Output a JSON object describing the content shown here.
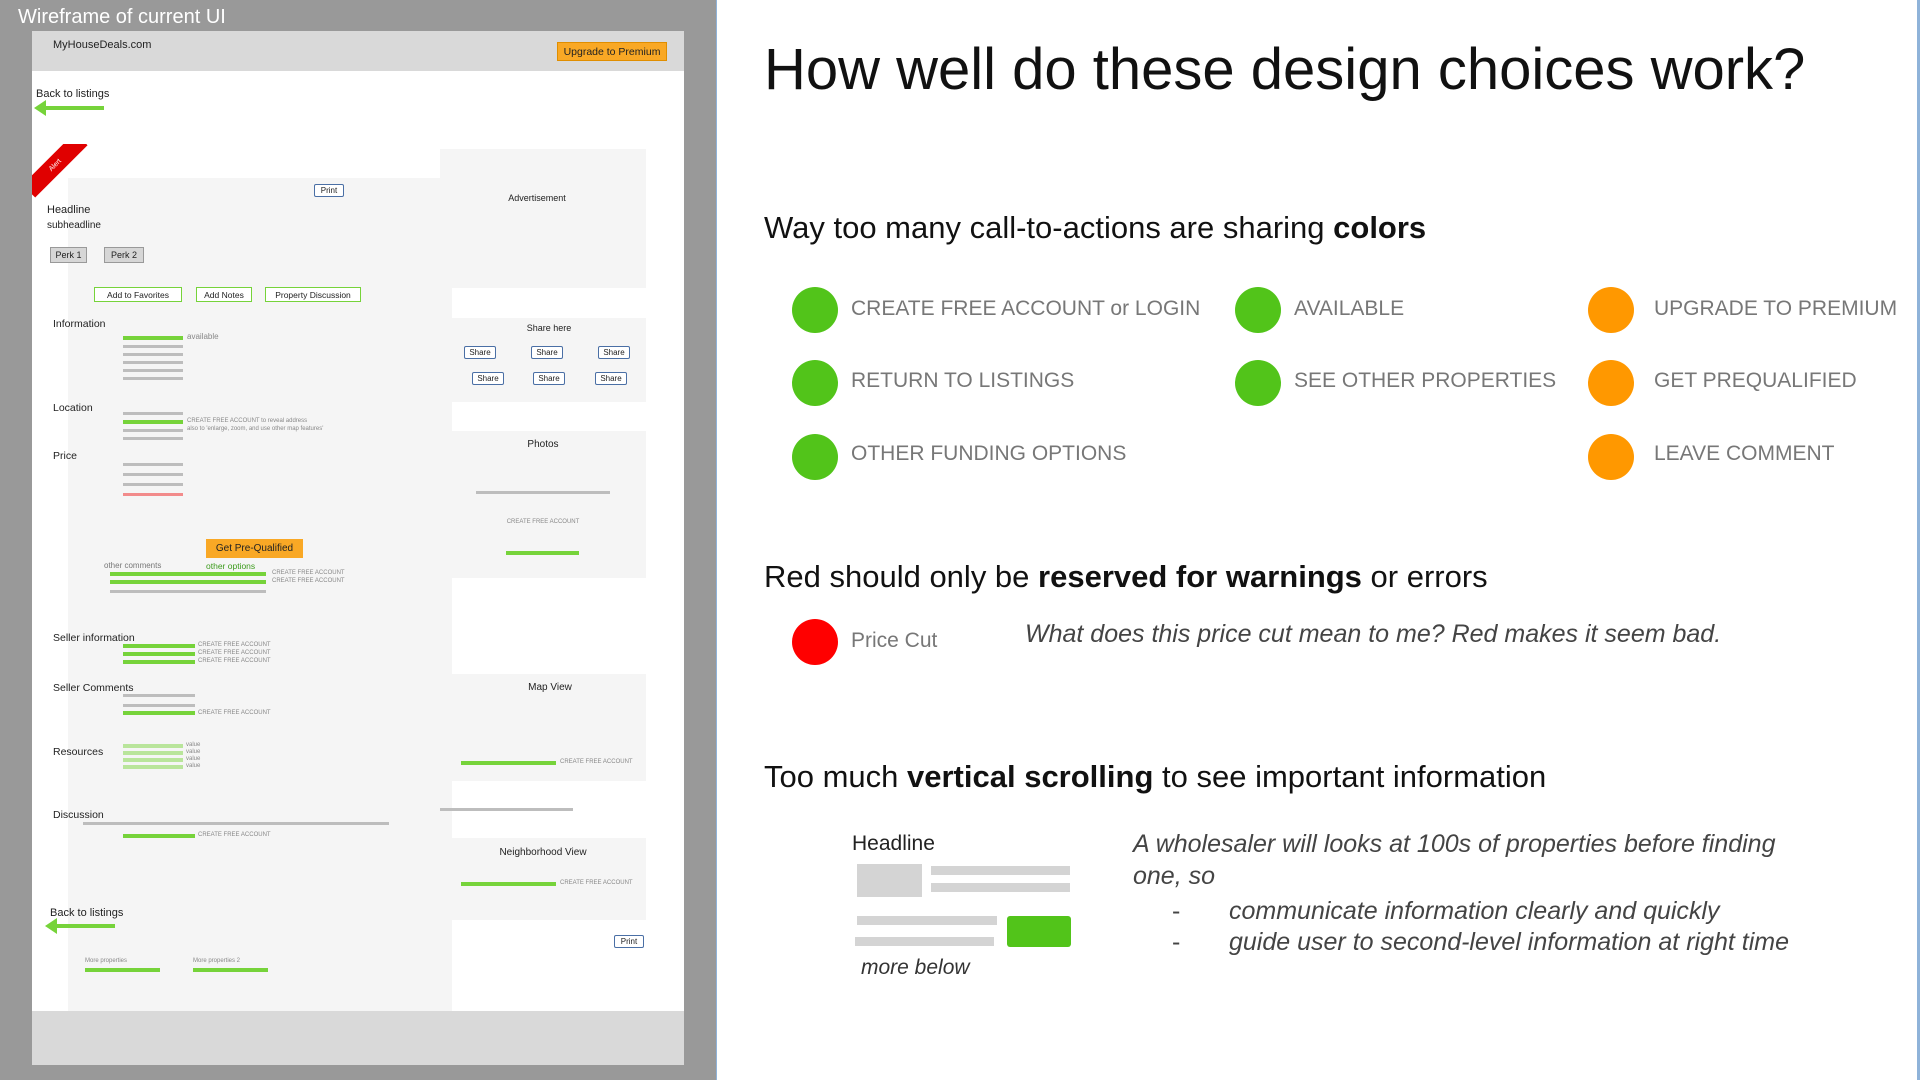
{
  "wireframe": {
    "title": "Wireframe of current UI",
    "site_name": "MyHouseDeals.com",
    "upgrade_button": "Upgrade to Premium",
    "back_to_listings": "Back to listings",
    "alert": "Alert",
    "print": "Print",
    "headline": "Headline",
    "subheadline": "subheadline",
    "perks": [
      "Perk 1",
      "Perk 2"
    ],
    "actions": [
      "Add  to Favorites",
      "Add Notes",
      "Property Discussion"
    ],
    "sections": {
      "information": "Information",
      "location": "Location",
      "price": "Price",
      "seller_information": "Seller information",
      "seller_comments": "Seller Comments",
      "resources": "Resources",
      "discussion": "Discussion"
    },
    "available": "available",
    "location_note1": "CREATE FREE ACCOUNT to reveal address",
    "location_note2": "also to 'enlarge, zoom, and use other map features'",
    "get_prequalified": "Get Pre-Qualified",
    "other_options": "other options",
    "other_comments": "other comments",
    "create_free_account": "CREATE FREE ACCOUNT",
    "value": "value",
    "more_properties": [
      "More properties",
      "More properties 2"
    ],
    "sidebar": {
      "advertisement": "Advertisement",
      "share_here": "Share here",
      "share": "Share",
      "photos": "Photos",
      "map_view": "Map View",
      "neighborhood_view": "Neighborhood View"
    }
  },
  "slide": {
    "title": "How well do these design choices work?",
    "colors_section": {
      "heading_prefix": "Way too many call-to-actions are sharing ",
      "heading_bold": "colors",
      "green_col1": [
        "CREATE FREE ACCOUNT or LOGIN",
        "RETURN TO LISTINGS",
        "OTHER FUNDING OPTIONS"
      ],
      "green_col2": [
        "AVAILABLE",
        "SEE OTHER PROPERTIES"
      ],
      "orange_col": [
        "UPGRADE TO PREMIUM",
        "GET PREQUALIFIED",
        "LEAVE COMMENT"
      ],
      "green_color": "#52c41a",
      "orange_color": "#ff9800"
    },
    "red_section": {
      "heading_prefix": "Red should only be ",
      "heading_bold": "reserved for warnings",
      "heading_suffix": " or errors",
      "price_cut": "Price Cut",
      "note": "What does this price cut mean to me? Red makes it seem bad.",
      "red_color": "#ff0000"
    },
    "scroll_section": {
      "heading_prefix": "Too much ",
      "heading_bold": "vertical scrolling",
      "heading_suffix": " to see important information",
      "mini_headline": "Headline",
      "more_below": "more below",
      "note_line1": "A wholesaler will looks at 100s of properties before finding",
      "note_line2": "one, so",
      "bullets": [
        "communicate information clearly and quickly",
        "guide user to second-level information at right time"
      ]
    }
  }
}
